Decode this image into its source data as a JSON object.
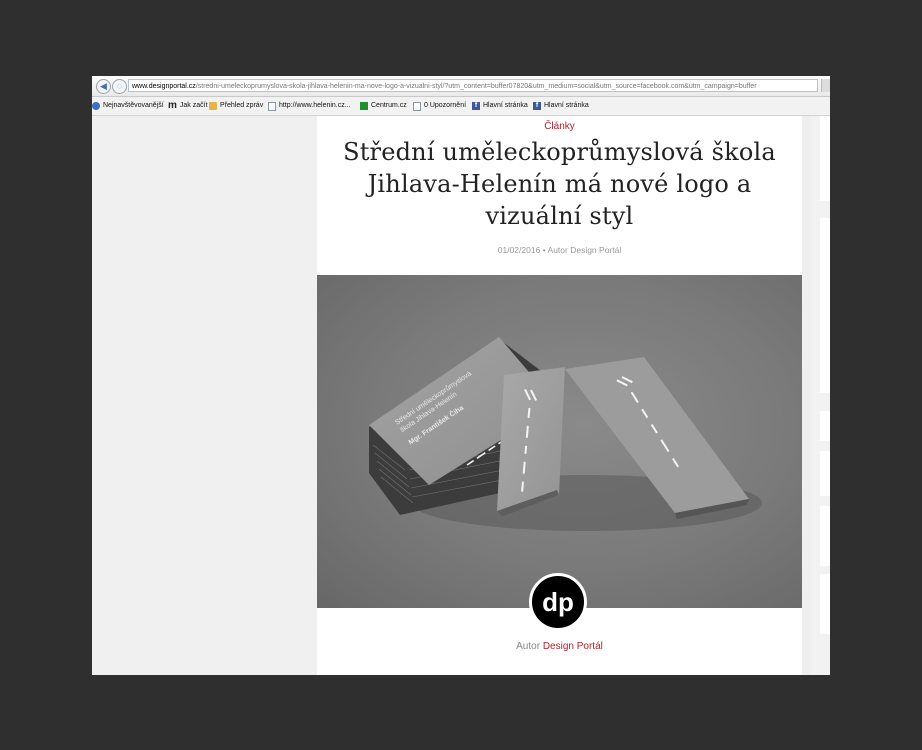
{
  "browser": {
    "url_domain": "www.designportal.cz",
    "url_path": "/stredni-umeleckoprumyslova-skola-jihlava-helenin-ma-nove-logo-a-vizualni-styl/?utm_content=buffer07820&utm_medium=social&utm_source=facebook.com&utm_campaign=buffer",
    "bookmarks": [
      {
        "label": "Nejnavštěvovanější",
        "icon": "star-icon"
      },
      {
        "label": "Jak začít",
        "icon": "m-icon"
      },
      {
        "label": "Přehled zpráv",
        "icon": "folder-icon"
      },
      {
        "label": "http://www.helenin.cz...",
        "icon": "page-icon"
      },
      {
        "label": "Centrum.cz",
        "icon": "centrum-icon"
      },
      {
        "label": "0 Upozornění",
        "icon": "page-icon"
      },
      {
        "label": "Hlavní stránka",
        "icon": "facebook-icon"
      },
      {
        "label": "Hlavní stránka",
        "icon": "facebook-icon"
      }
    ]
  },
  "article": {
    "category": "Články",
    "title": "Střední uměleckoprůmyslová škola Jihlava-Helenín má nové logo a vizuální styl",
    "meta": "01/02/2016 • Autor Design Portál",
    "author_prefix": "Autor",
    "author_name": "Design Portál",
    "avatar_text": "dp",
    "card_text": {
      "school_line1": "Střední uměleckoprůmyslová",
      "school_line2": "škola Jihlava-Helenín",
      "person": "Mgr. František Čiha"
    }
  },
  "colors": {
    "accent": "#b2222a",
    "page_bg": "#2f2f2f"
  }
}
